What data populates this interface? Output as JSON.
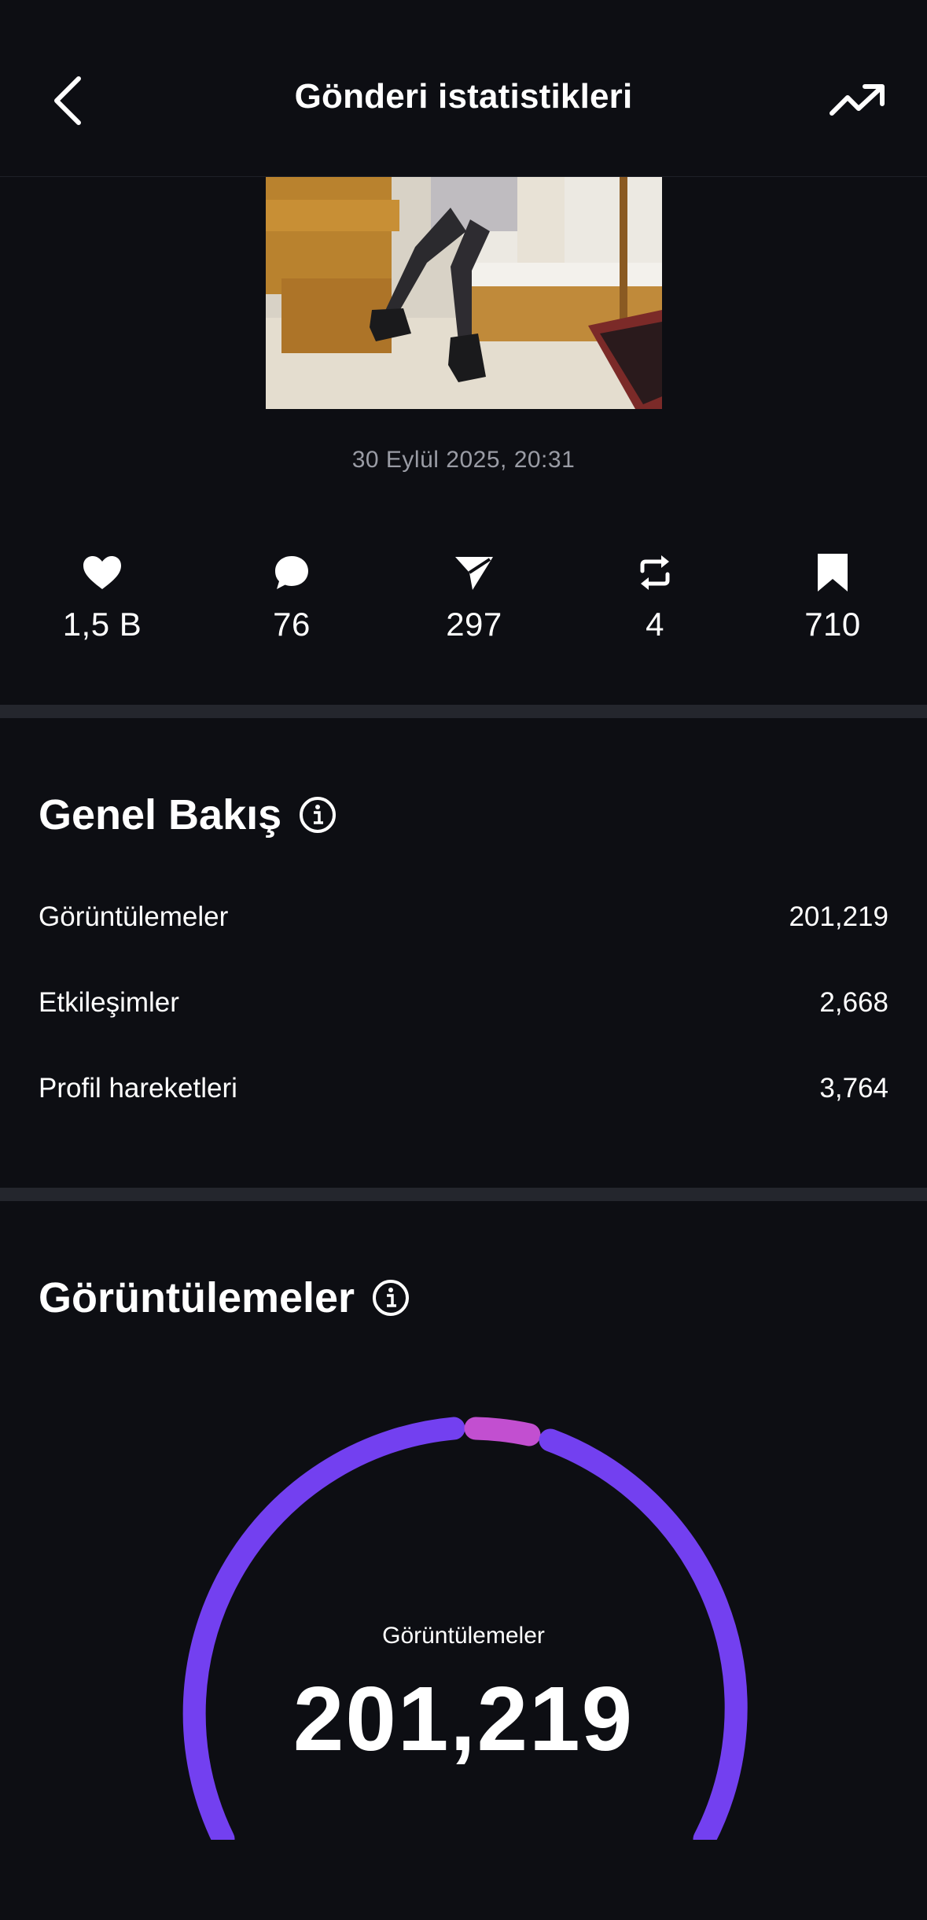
{
  "header": {
    "title": "Gönderi istatistikleri",
    "back_icon": "chevron-left-icon",
    "trend_icon": "trending-up-icon"
  },
  "post": {
    "date": "30 Eylül 2025, 20:31"
  },
  "metrics": [
    {
      "icon": "heart-icon",
      "value": "1,5 B"
    },
    {
      "icon": "comment-icon",
      "value": "76"
    },
    {
      "icon": "send-icon",
      "value": "297"
    },
    {
      "icon": "repost-icon",
      "value": "4"
    },
    {
      "icon": "bookmark-icon",
      "value": "710"
    }
  ],
  "overview": {
    "title": "Genel Bakış",
    "rows": [
      {
        "label": "Görüntülemeler",
        "value": "201,219"
      },
      {
        "label": "Etkileşimler",
        "value": "2,668"
      },
      {
        "label": "Profil hareketleri",
        "value": "3,764"
      }
    ]
  },
  "views": {
    "title": "Görüntülemeler",
    "gauge_label": "Görüntülemeler",
    "gauge_value": "201,219",
    "colors": {
      "primary": "#7340f0",
      "secondary": "#c24fd0"
    }
  },
  "colors": {
    "background": "#0d0e13",
    "divider": "#24262d",
    "muted_text": "#9a9ca5"
  }
}
